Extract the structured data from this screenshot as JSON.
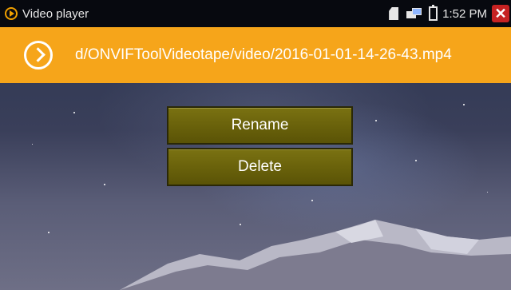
{
  "status_bar": {
    "app_title": "Video player",
    "time": "1:52 PM",
    "close_glyph": "✕",
    "icons": [
      "play-icon",
      "sd-card-icon",
      "network-icon",
      "battery-icon",
      "close-icon"
    ]
  },
  "path_bar": {
    "path": "d/ONVIFToolVideotape/video/2016-01-01-14-26-43.mp4",
    "accent_color": "#f6a51a"
  },
  "menu": {
    "items": [
      {
        "label": "Rename"
      },
      {
        "label": "Delete"
      }
    ],
    "button_color": "#6a620b"
  }
}
